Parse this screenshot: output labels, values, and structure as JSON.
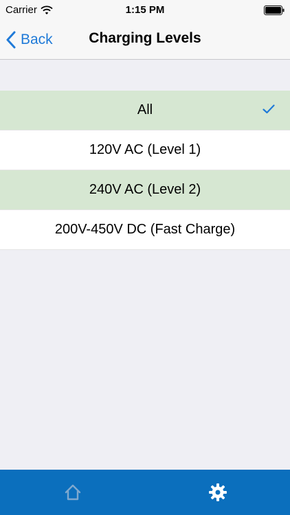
{
  "status_bar": {
    "carrier": "Carrier",
    "time": "1:15 PM",
    "icons": [
      "wifi-icon",
      "battery-icon"
    ]
  },
  "nav": {
    "back_label": "Back",
    "title": "Charging Levels",
    "back_icon": "chevron-left-icon"
  },
  "options": [
    {
      "label": "All",
      "checked": true
    },
    {
      "label": "120V AC (Level 1)",
      "checked": false
    },
    {
      "label": "240V AC (Level 2)",
      "checked": false
    },
    {
      "label": "200V-450V DC (Fast Charge)",
      "checked": false
    }
  ],
  "tab_bar": {
    "tabs": [
      {
        "icon": "home-icon",
        "active": false
      },
      {
        "icon": "gear-icon",
        "active": true
      }
    ]
  },
  "colors": {
    "accent": "#1f7ad8",
    "selected_row": "#d6e7d2",
    "tab_bar": "#0b6fbd",
    "background": "#efeff4"
  }
}
